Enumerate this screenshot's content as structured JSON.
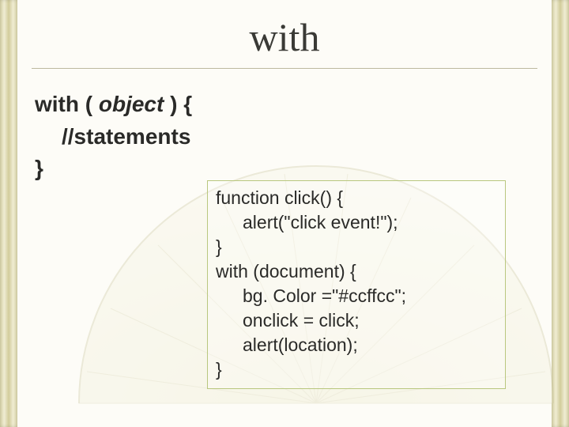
{
  "title": "with",
  "syntax": {
    "l1_kw": "with ( ",
    "l1_obj": "object",
    "l1_end": " ) {",
    "l2": "//statements",
    "l3": "}"
  },
  "code": {
    "l1": "function click() {",
    "l2": "alert(\"click event!\");",
    "l3": "}",
    "l4": "with (document) {",
    "l5": "bg. Color =\"#ccffcc\";",
    "l6": "onclick = click;",
    "l7": "alert(location);",
    "l8": "}"
  }
}
